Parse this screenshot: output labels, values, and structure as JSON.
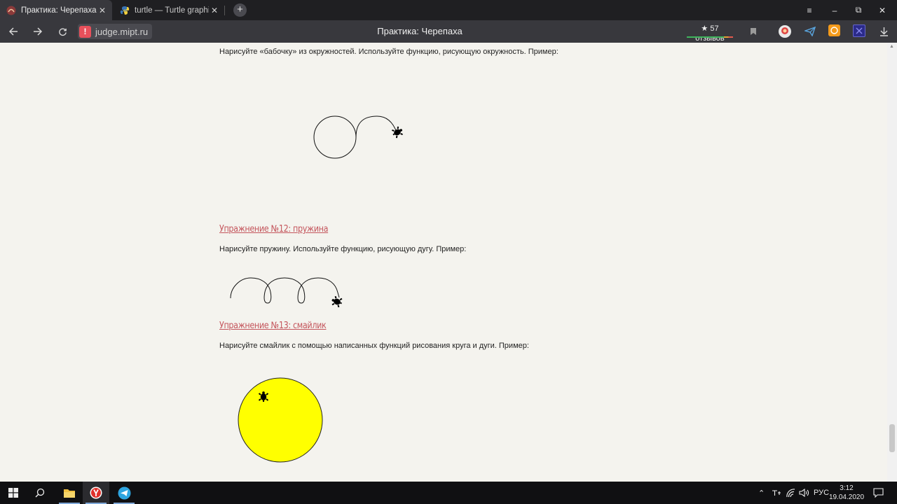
{
  "browser": {
    "tabs": [
      {
        "title": "Практика: Черепаха",
        "active": true
      },
      {
        "title": "turtle — Turtle graphics —",
        "active": false
      }
    ],
    "address": {
      "host": "judge.mipt.ru"
    },
    "page_title": "Практика: Черепаха",
    "reviews_label": "★ 57 отзывов",
    "window_controls": {
      "menu": "≡",
      "minimize": "–",
      "restore": "⧉",
      "close": "✕"
    }
  },
  "article": {
    "butterfly_text": "Нарисуйте «бабочку» из окружностей. Используйте функцию, рисующую окружность. Пример:",
    "ex12_heading": "Упражнение №12: пружина",
    "ex12_text": "Нарисуйте пружину. Используйте функцию, рисующую дугу. Пример:",
    "ex13_heading": "Упражнение №13: смайлик",
    "ex13_text": "Нарисуйте смайлик с помощью написанных функций рисования круга и дуги. Пример:",
    "smiley_fill": "#ffff00",
    "heading_color": "#c4555c"
  },
  "taskbar": {
    "tray_lang": "РУС",
    "time": "3:12",
    "date": "19.04.2020"
  }
}
